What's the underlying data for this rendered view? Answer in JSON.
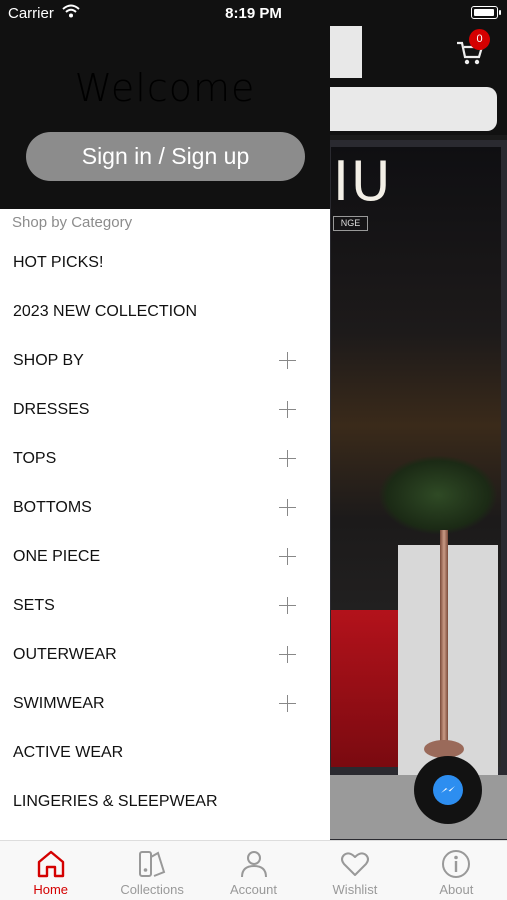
{
  "status_bar": {
    "carrier": "Carrier",
    "time": "8:19 PM"
  },
  "header": {
    "cart_count": "0"
  },
  "drawer": {
    "welcome": "Welcome",
    "signin_label": "Sign in / Sign up",
    "section_label": "Shop by Category",
    "items": [
      {
        "label": "HOT PICKS!",
        "expandable": false
      },
      {
        "label": "2023 NEW COLLECTION",
        "expandable": false
      },
      {
        "label": "SHOP BY",
        "expandable": true
      },
      {
        "label": "DRESSES",
        "expandable": true
      },
      {
        "label": "TOPS",
        "expandable": true
      },
      {
        "label": "BOTTOMS",
        "expandable": true
      },
      {
        "label": "ONE PIECE",
        "expandable": true
      },
      {
        "label": "SETS",
        "expandable": true
      },
      {
        "label": "OUTERWEAR",
        "expandable": true
      },
      {
        "label": "SWIMWEAR",
        "expandable": true
      },
      {
        "label": "ACTIVE WEAR",
        "expandable": false
      },
      {
        "label": "LINGERIES & SLEEPWEAR",
        "expandable": false
      }
    ]
  },
  "hero": {
    "sign_text": "IU",
    "sign_sub": "NGE"
  },
  "tabs": [
    {
      "label": "Home",
      "icon": "home-icon",
      "active": true
    },
    {
      "label": "Collections",
      "icon": "collections-icon",
      "active": false
    },
    {
      "label": "Account",
      "icon": "account-icon",
      "active": false
    },
    {
      "label": "Wishlist",
      "icon": "heart-icon",
      "active": false
    },
    {
      "label": "About",
      "icon": "info-icon",
      "active": false
    }
  ],
  "colors": {
    "accent": "#d40000",
    "drawer_header": "#111111",
    "signin_button": "#8c8c8c"
  }
}
